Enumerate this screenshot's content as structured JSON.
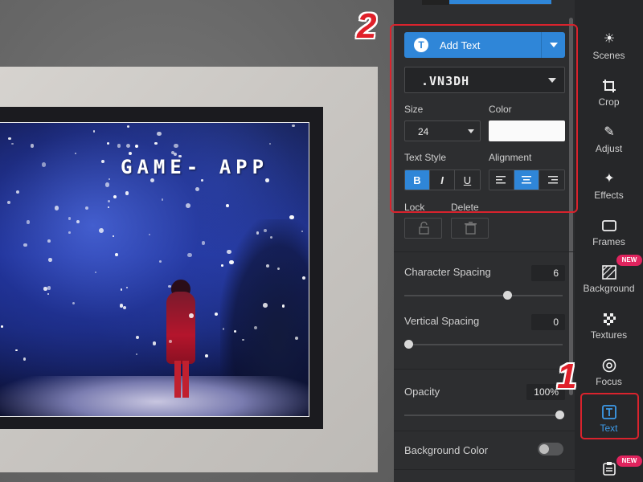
{
  "canvas": {
    "image_text": "GAME- APP"
  },
  "text_panel": {
    "add_text_label": "Add Text",
    "font_value": ".VN3DH",
    "size_label": "Size",
    "size_value": "24",
    "color_label": "Color",
    "color_value": "#fafafa",
    "text_style_label": "Text Style",
    "alignment_label": "Alignment",
    "style_buttons": [
      "B",
      "I",
      "U"
    ],
    "lock_label": "Lock",
    "delete_label": "Delete",
    "character_spacing": {
      "label": "Character Spacing",
      "value": "6"
    },
    "vertical_spacing": {
      "label": "Vertical Spacing",
      "value": "0"
    },
    "opacity": {
      "label": "Opacity",
      "value": "100%"
    },
    "background_color": {
      "label": "Background Color",
      "enabled": false
    }
  },
  "sidebar": {
    "items": [
      {
        "label": "Scenes",
        "icon": "scenes-icon"
      },
      {
        "label": "Crop",
        "icon": "crop-icon"
      },
      {
        "label": "Adjust",
        "icon": "adjust-icon"
      },
      {
        "label": "Effects",
        "icon": "effects-icon"
      },
      {
        "label": "Frames",
        "icon": "frames-icon"
      },
      {
        "label": "Background",
        "icon": "background-icon",
        "badge": "NEW"
      },
      {
        "label": "Textures",
        "icon": "textures-icon"
      },
      {
        "label": "Focus",
        "icon": "focus-icon"
      },
      {
        "label": "Text",
        "icon": "text-icon",
        "active": true
      }
    ],
    "bottom_badge": "NEW"
  },
  "annotations": {
    "step1": "1",
    "step2": "2"
  },
  "colors": {
    "accent": "#2f86d8",
    "annotation_red": "#d9232d",
    "panel_bg": "#2d2e30"
  }
}
